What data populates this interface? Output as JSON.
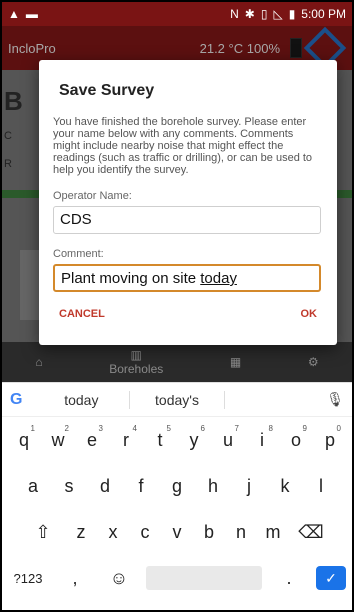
{
  "status_bar": {
    "icons_left": [
      "warning-icon",
      "image-icon"
    ],
    "icons_right": [
      "nfc-icon",
      "bluetooth-icon",
      "vibrate-icon",
      "no-signal-icon",
      "battery-icon"
    ],
    "time": "5:00 PM"
  },
  "app_bar": {
    "title": "IncloPro",
    "temperature": "21.2 °C",
    "battery": "100%",
    "brand_color": "#7a1414"
  },
  "background": {
    "big_letter": "B",
    "letter_c": "C",
    "letter_r": "R"
  },
  "bottom_nav": {
    "items": [
      {
        "icon": "home-icon",
        "label": ""
      },
      {
        "icon": "boreholes-icon",
        "label": "Boreholes"
      },
      {
        "icon": "grid-icon",
        "label": ""
      },
      {
        "icon": "settings-icon",
        "label": ""
      }
    ]
  },
  "dialog": {
    "title": "Save Survey",
    "body": "You have finished the borehole survey. Please enter your name below with any comments. Comments might include nearby noise that might effect the readings (such as traffic or drilling), or can be used to help you identify the survey.",
    "operator_label": "Operator Name:",
    "operator_value": "CDS",
    "comment_label": "Comment:",
    "comment_value_prefix": "Plant moving on site ",
    "comment_value_underlined": "today",
    "cancel": "CANCEL",
    "ok": "OK",
    "accent": "#d4892b"
  },
  "keyboard": {
    "suggestions": [
      "today",
      "today's",
      ""
    ],
    "row1": [
      {
        "k": "q",
        "n": "1"
      },
      {
        "k": "w",
        "n": "2"
      },
      {
        "k": "e",
        "n": "3"
      },
      {
        "k": "r",
        "n": "4"
      },
      {
        "k": "t",
        "n": "5"
      },
      {
        "k": "y",
        "n": "6"
      },
      {
        "k": "u",
        "n": "7"
      },
      {
        "k": "i",
        "n": "8"
      },
      {
        "k": "o",
        "n": "9"
      },
      {
        "k": "p",
        "n": "0"
      }
    ],
    "row2": [
      "a",
      "s",
      "d",
      "f",
      "g",
      "h",
      "j",
      "k",
      "l"
    ],
    "row3": [
      "z",
      "x",
      "c",
      "v",
      "b",
      "n",
      "m"
    ],
    "mode_key": "?123",
    "comma": ",",
    "period": "."
  }
}
